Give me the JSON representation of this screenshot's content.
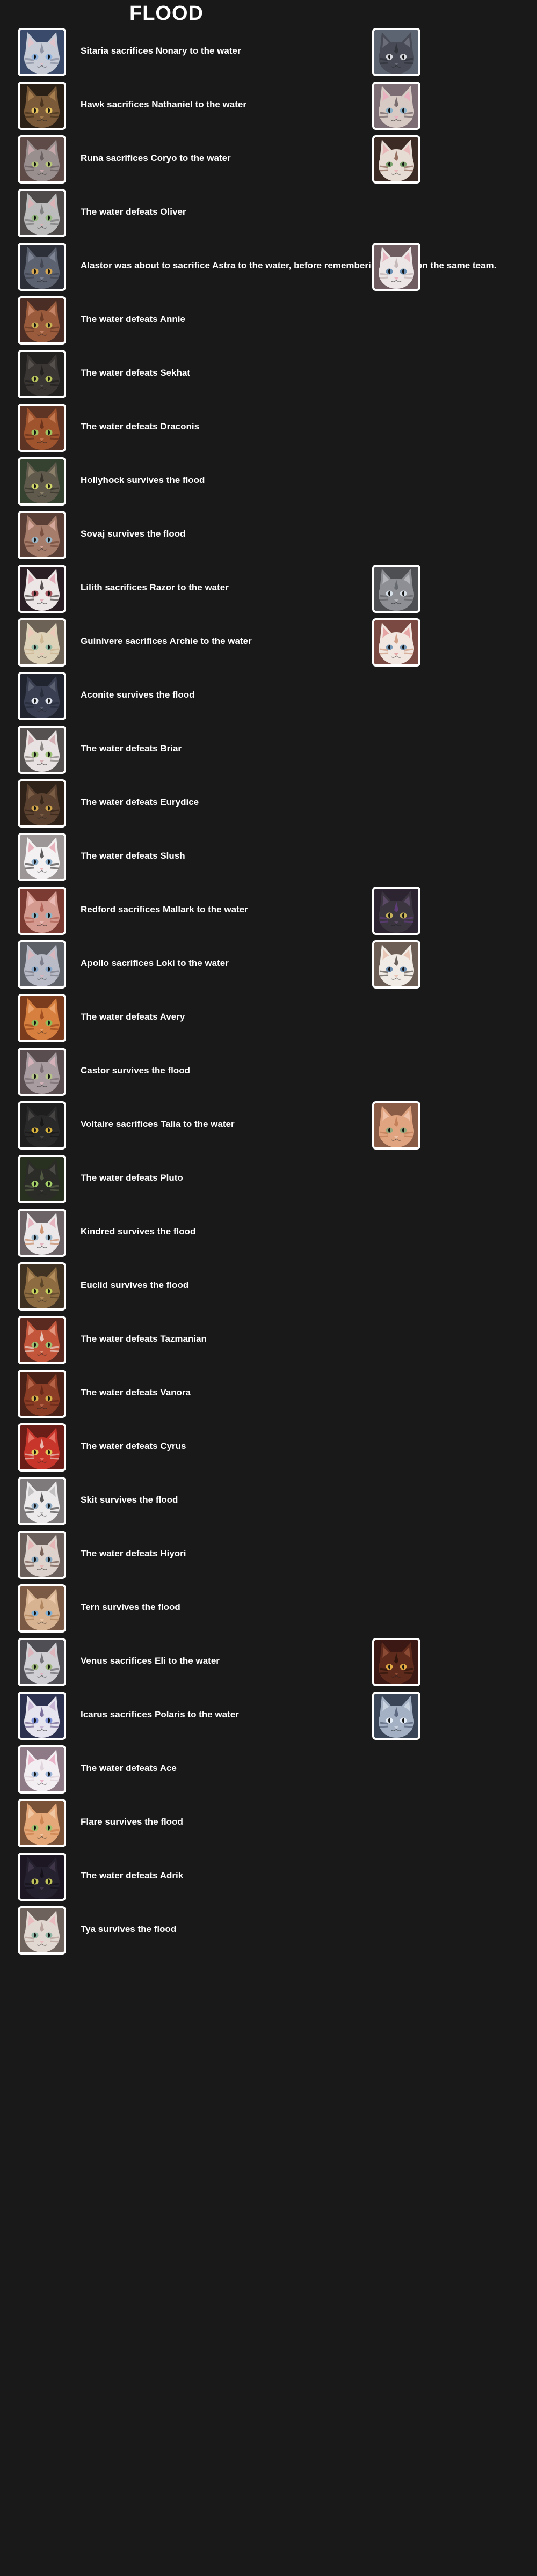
{
  "title": "FLOOD",
  "events": [
    {
      "text": "Sitaria sacrifices Nonary to the water",
      "icon": "cat-portrait-icon",
      "primary": {
        "bg": "#3a4a6a",
        "fur": "#c7cbd6",
        "ear": "#e0c4cc",
        "eye": "#8fb4e0",
        "stripe": "#7c8294"
      },
      "secondary": {
        "bg": "#5b6470",
        "fur": "#484b55",
        "ear": "#6b6e78",
        "eye": "#d7d9de",
        "stripe": "#2c2e36"
      }
    },
    {
      "text": "Hawk sacrifices Nathaniel to the water",
      "icon": "cat-portrait-icon",
      "primary": {
        "bg": "#2b2016",
        "fur": "#7a5a38",
        "ear": "#a57c4d",
        "eye": "#e5c25e",
        "stripe": "#3d2a18"
      },
      "secondary": {
        "bg": "#7b6d73",
        "fur": "#d7c9c3",
        "ear": "#e9b0c0",
        "eye": "#8bb1c9",
        "stripe": "#5b4e53"
      }
    },
    {
      "text": "Runa sacrifices Coryo to the water",
      "icon": "cat-portrait-icon",
      "primary": {
        "bg": "#5e4b48",
        "fur": "#9a8f8f",
        "ear": "#c7a8aa",
        "eye": "#b7c77a",
        "stripe": "#5b5052"
      },
      "secondary": {
        "bg": "#3c2a25",
        "fur": "#e7dcd4",
        "ear": "#e8b8b8",
        "eye": "#7ca36f",
        "stripe": "#7a4c3a"
      }
    },
    {
      "text": "The water defeats Oliver",
      "icon": "cat-portrait-icon",
      "primary": {
        "bg": "#4e4a4a",
        "fur": "#bdbcbc",
        "ear": "#d9b2b6",
        "eye": "#97b982",
        "stripe": "#6d6d6d"
      }
    },
    {
      "text": "Alastor was about to sacrifice Astra to the water, before remembering they're on the same team.",
      "icon": "cat-portrait-icon",
      "primary": {
        "bg": "#2c2f38",
        "fur": "#5d6270",
        "ear": "#7e8394",
        "eye": "#d8a850",
        "stripe": "#3b3f4a"
      },
      "secondary": {
        "bg": "#6e5c61",
        "fur": "#ece7e6",
        "ear": "#e8b6c1",
        "eye": "#6a90b3",
        "stripe": "#b9a9a9"
      }
    },
    {
      "text": "The water defeats Annie",
      "icon": "cat-portrait-icon",
      "primary": {
        "bg": "#4a2e25",
        "fur": "#9a5b3c",
        "ear": "#c48264",
        "eye": "#c9b253",
        "stripe": "#5c3120"
      }
    },
    {
      "text": "The water defeats Sekhat",
      "icon": "cat-portrait-icon",
      "primary": {
        "bg": "#242221",
        "fur": "#3a3634",
        "ear": "#55504c",
        "eye": "#b8c25c",
        "stripe": "#1c1a19"
      }
    },
    {
      "text": "The water defeats Draconis",
      "icon": "cat-portrait-icon",
      "primary": {
        "bg": "#5e3424",
        "fur": "#a0542e",
        "ear": "#c2774f",
        "eye": "#9fc460",
        "stripe": "#5b2a17"
      }
    },
    {
      "text": "Hollyhock survives the flood",
      "icon": "cat-portrait-icon",
      "primary": {
        "bg": "#354230",
        "fur": "#5f5a4c",
        "ear": "#8b7f6a",
        "eye": "#cfd56a",
        "stripe": "#2d2a22"
      }
    },
    {
      "text": "Sovaj survives the flood",
      "icon": "cat-portrait-icon",
      "primary": {
        "bg": "#5a3f37",
        "fur": "#a67c6a",
        "ear": "#d5a79a",
        "eye": "#9ab6c7",
        "stripe": "#6c4335"
      }
    },
    {
      "text": "Lilith sacrifices Razor to the water",
      "icon": "cat-portrait-icon",
      "primary": {
        "bg": "#2a1f24",
        "fur": "#ece6e6",
        "ear": "#e3aeb9",
        "eye": "#a2505a",
        "stripe": "#251d20"
      },
      "secondary": {
        "bg": "#4d4f52",
        "fur": "#8d8f94",
        "ear": "#b3b5ba",
        "eye": "#d8e0ea",
        "stripe": "#5a5c60"
      }
    },
    {
      "text": "Guinivere sacrifices Archie to the water",
      "icon": "cat-portrait-icon",
      "primary": {
        "bg": "#6d6256",
        "fur": "#ddd1b8",
        "ear": "#ecc8b9",
        "eye": "#92b9a3",
        "stripe": "#c6ad86"
      },
      "secondary": {
        "bg": "#7a4a42",
        "fur": "#f1e7e0",
        "ear": "#e6a6a6",
        "eye": "#7a9ab8",
        "stripe": "#c78a6c"
      }
    },
    {
      "text": "Aconite survives the flood",
      "icon": "cat-portrait-icon",
      "primary": {
        "bg": "#20242e",
        "fur": "#3a4052",
        "ear": "#5a6070",
        "eye": "#e3e7ef",
        "stripe": "#242836"
      }
    },
    {
      "text": "The water defeats Briar",
      "icon": "cat-portrait-icon",
      "primary": {
        "bg": "#555150",
        "fur": "#e8e3e2",
        "ear": "#d4b0b4",
        "eye": "#9bbf74",
        "stripe": "#6e6866"
      }
    },
    {
      "text": "The water defeats Eurydice",
      "icon": "cat-portrait-icon",
      "primary": {
        "bg": "#2f2219",
        "fur": "#5b4230",
        "ear": "#7a5b44",
        "eye": "#cda24a",
        "stripe": "#2b1d13"
      }
    },
    {
      "text": "The water defeats Slush",
      "icon": "cat-portrait-icon",
      "primary": {
        "bg": "#9c9696",
        "fur": "#f3f1f1",
        "ear": "#e8b3bc",
        "eye": "#8fb0cc",
        "stripe": "#2c2a2b"
      }
    },
    {
      "text": "Redford sacrifices Mallark to the water",
      "icon": "cat-portrait-icon",
      "primary": {
        "bg": "#7b3b33",
        "fur": "#d59a8f",
        "ear": "#eab8b2",
        "eye": "#8fb6c6",
        "stripe": "#a55346"
      },
      "secondary": {
        "bg": "#2c2430",
        "fur": "#3b3540",
        "ear": "#5b4a66",
        "eye": "#c6b25a",
        "stripe": "#6a3f8a"
      }
    },
    {
      "text": "Apollo sacrifices Loki to the water",
      "icon": "cat-portrait-icon",
      "primary": {
        "bg": "#5e6068",
        "fur": "#b9bcc6",
        "ear": "#d6b6bc",
        "eye": "#86a6c9",
        "stripe": "#6b6e79"
      },
      "secondary": {
        "bg": "#6d5e55",
        "fur": "#f0ebe4",
        "ear": "#e9c7b6",
        "eye": "#6b8db0",
        "stripe": "#3d3430"
      }
    },
    {
      "text": "The water defeats Avery",
      "icon": "cat-portrait-icon",
      "primary": {
        "bg": "#7b3c1e",
        "fur": "#d77f3e",
        "ear": "#eaa36d",
        "eye": "#8fbd5a",
        "stripe": "#8f3f17"
      }
    },
    {
      "text": "Castor survives the flood",
      "icon": "cat-portrait-icon",
      "primary": {
        "bg": "#5a4d50",
        "fur": "#a89ca0",
        "ear": "#d4b0b8",
        "eye": "#b5c58a",
        "stripe": "#6e6266"
      }
    },
    {
      "text": "Voltaire sacrifices Talia to the water",
      "icon": "cat-portrait-icon",
      "primary": {
        "bg": "#1f1e1e",
        "fur": "#2a2929",
        "ear": "#454242",
        "eye": "#d8b23c",
        "stripe": "#141313"
      },
      "secondary": {
        "bg": "#8a5b45",
        "fur": "#e0a480",
        "ear": "#efc1a8",
        "eye": "#8fa77a",
        "stripe": "#b9744c"
      }
    },
    {
      "text": "The water defeats Pluto",
      "icon": "cat-portrait-icon",
      "primary": {
        "bg": "#28301f",
        "fur": "#2b2b28",
        "ear": "#4b4a44",
        "eye": "#a4cf68",
        "stripe": "#5f6b4a"
      }
    },
    {
      "text": "Kindred survives the flood",
      "icon": "cat-portrait-icon",
      "primary": {
        "bg": "#6b6366",
        "fur": "#ece7e8",
        "ear": "#e6b4bf",
        "eye": "#9ab7c9",
        "stripe": "#c07a4e"
      }
    },
    {
      "text": "Euclid survives the flood",
      "icon": "cat-portrait-icon",
      "primary": {
        "bg": "#3f3222",
        "fur": "#8d6c42",
        "ear": "#b38c5c",
        "eye": "#c5d25c",
        "stripe": "#4c3a22"
      }
    },
    {
      "text": "The water defeats Tazmanian",
      "icon": "cat-portrait-icon",
      "primary": {
        "bg": "#5a2a20",
        "fur": "#c2553a",
        "ear": "#e2937c",
        "eye": "#9fc070",
        "stripe": "#f2ede8"
      }
    },
    {
      "text": "The water defeats Vanora",
      "icon": "cat-portrait-icon",
      "primary": {
        "bg": "#4a2218",
        "fur": "#8c3d26",
        "ear": "#b56246",
        "eye": "#d6b04a",
        "stripe": "#5e2314"
      }
    },
    {
      "text": "The water defeats Cyrus",
      "icon": "cat-portrait-icon",
      "primary": {
        "bg": "#6b1d18",
        "fur": "#c8362b",
        "ear": "#e57466",
        "eye": "#e2cb5a",
        "stripe": "#f1e5dc"
      }
    },
    {
      "text": "Skit survives the flood",
      "icon": "cat-portrait-icon",
      "primary": {
        "bg": "#7e7a7c",
        "fur": "#eceaeb",
        "ear": "#c4c1c2",
        "eye": "#8eaac2",
        "stripe": "#2c2a2b"
      }
    },
    {
      "text": "The water defeats Hiyori",
      "icon": "cat-portrait-icon",
      "primary": {
        "bg": "#6a5f5a",
        "fur": "#ddd3cc",
        "ear": "#e5b5b5",
        "eye": "#86a8c0",
        "stripe": "#5a4036"
      }
    },
    {
      "text": "Tern survives the flood",
      "icon": "cat-portrait-icon",
      "primary": {
        "bg": "#7a5a44",
        "fur": "#d8b391",
        "ear": "#ecc8aa",
        "eye": "#7cb0d6",
        "stripe": "#a6784f"
      }
    },
    {
      "text": "Venus sacrifices Eli to the water",
      "icon": "cat-portrait-icon",
      "primary": {
        "bg": "#4e4e54",
        "fur": "#cfcfd4",
        "ear": "#dcb6bc",
        "eye": "#9bb57a",
        "stripe": "#55555c"
      },
      "secondary": {
        "bg": "#3c1814",
        "fur": "#5e2a1c",
        "ear": "#8a4a34",
        "eye": "#e2a944",
        "stripe": "#241008"
      }
    },
    {
      "text": "Icarus sacrifices Polaris to the water",
      "icon": "cat-portrait-icon",
      "primary": {
        "bg": "#2d3150",
        "fur": "#e6e4ee",
        "ear": "#c9b6d6",
        "eye": "#7a8fd6",
        "stripe": "#5a4a80"
      },
      "secondary": {
        "bg": "#3a4658",
        "fur": "#a4b1c4",
        "ear": "#c9d3e0",
        "eye": "#e6eef7",
        "stripe": "#46516a"
      }
    },
    {
      "text": "The water defeats Ace",
      "icon": "cat-portrait-icon",
      "primary": {
        "bg": "#8d7a86",
        "fur": "#f3eef2",
        "ear": "#eab4c9",
        "eye": "#9ab3d6",
        "stripe": "#d9ccd4"
      }
    },
    {
      "text": "Flare survives the flood",
      "icon": "cat-portrait-icon",
      "primary": {
        "bg": "#7a5238",
        "fur": "#e5a878",
        "ear": "#f0c6a2",
        "eye": "#9fc06e",
        "stripe": "#c47a45"
      }
    },
    {
      "text": "The water defeats Adrik",
      "icon": "cat-portrait-icon",
      "primary": {
        "bg": "#1c1722",
        "fur": "#26212e",
        "ear": "#3e3548",
        "eye": "#c3c45a",
        "stripe": "#120e16"
      }
    },
    {
      "text": "Tya survives the flood",
      "icon": "cat-portrait-icon",
      "primary": {
        "bg": "#6e625c",
        "fur": "#e2d8d2",
        "ear": "#e9bdc0",
        "eye": "#8fb5a4",
        "stripe": "#a8928a"
      }
    }
  ]
}
